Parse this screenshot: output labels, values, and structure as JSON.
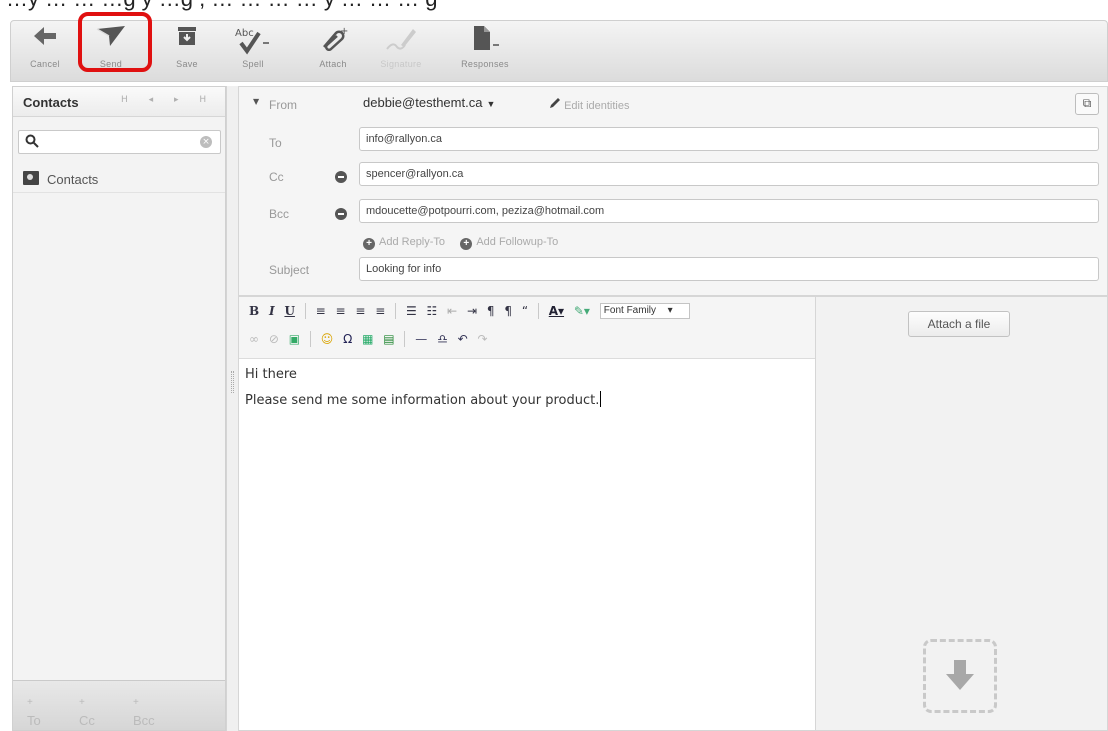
{
  "caption": {
    "text": "…y … … …g y …g , … … … … y … … … g"
  },
  "toolbar": {
    "cancel_label": "Cancel",
    "send_label": "Send",
    "save_label": "Save",
    "spell_label": "Spell",
    "attach_label": "Attach",
    "signature_label": "Signature",
    "responses_label": "Responses"
  },
  "sidebar": {
    "title": "Contacts",
    "pager": "H ◂ ▸ H",
    "search_placeholder": "",
    "items": [
      {
        "label": "Contacts"
      }
    ],
    "footer": {
      "to": "To",
      "cc": "Cc",
      "bcc": "Bcc"
    }
  },
  "headers": {
    "from_label": "From",
    "from_value": "debbie@testhemt.ca",
    "edit_identities": "Edit identities",
    "to_label": "To",
    "to_value": "info@rallyon.ca",
    "cc_label": "Cc",
    "cc_value": "spencer@rallyon.ca",
    "bcc_label": "Bcc",
    "bcc_value": "mdoucette@potpourri.com, peziza@hotmail.com",
    "add_reply_to": "Add Reply-To",
    "add_followup_to": "Add Followup-To",
    "subject_label": "Subject",
    "subject_value": "Looking for info"
  },
  "editor": {
    "font_family": "Font Family",
    "body_line1": "Hi there",
    "body_line2": "Please send me some information about your product."
  },
  "attachments": {
    "attach_button": "Attach a file"
  },
  "colors": {
    "highlight": "#e01010",
    "toolbar_bg": "#e6e6e6",
    "sidebar_bg": "#f3f3f3"
  }
}
